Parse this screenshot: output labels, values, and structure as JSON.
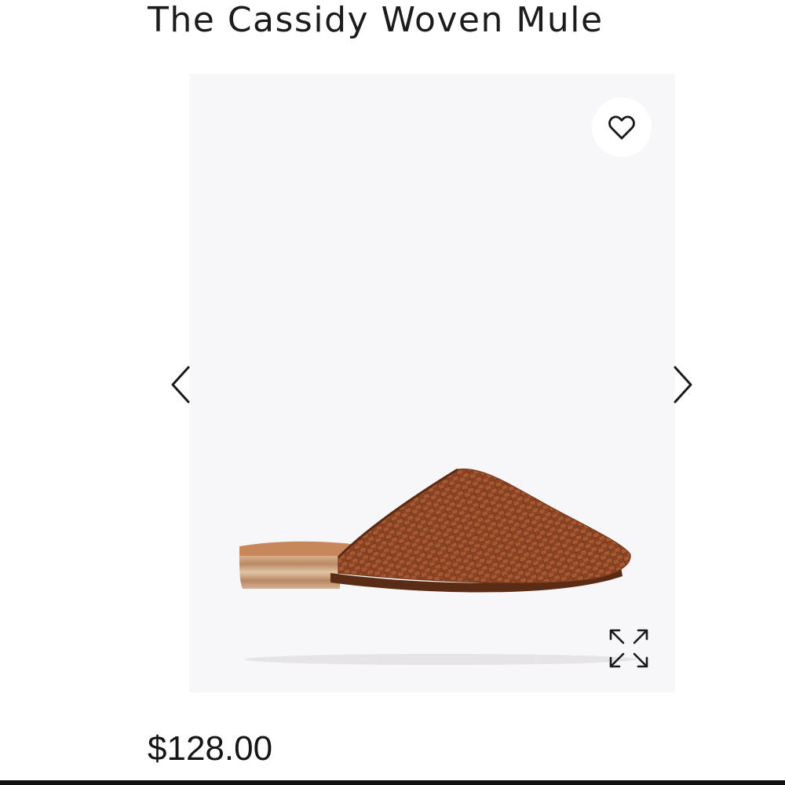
{
  "product": {
    "title": "The Cassidy Woven Mule",
    "price": "$128.00"
  },
  "gallery": {
    "favorite_icon": "heart-outline-icon",
    "expand_icon": "expand-arrows-icon",
    "prev_icon": "chevron-left-icon",
    "next_icon": "chevron-right-icon",
    "image_subject": "woven leather mule",
    "colors": {
      "background": "#f7f6f8",
      "leather": "#a85a32",
      "heel": "#c49a78"
    }
  }
}
